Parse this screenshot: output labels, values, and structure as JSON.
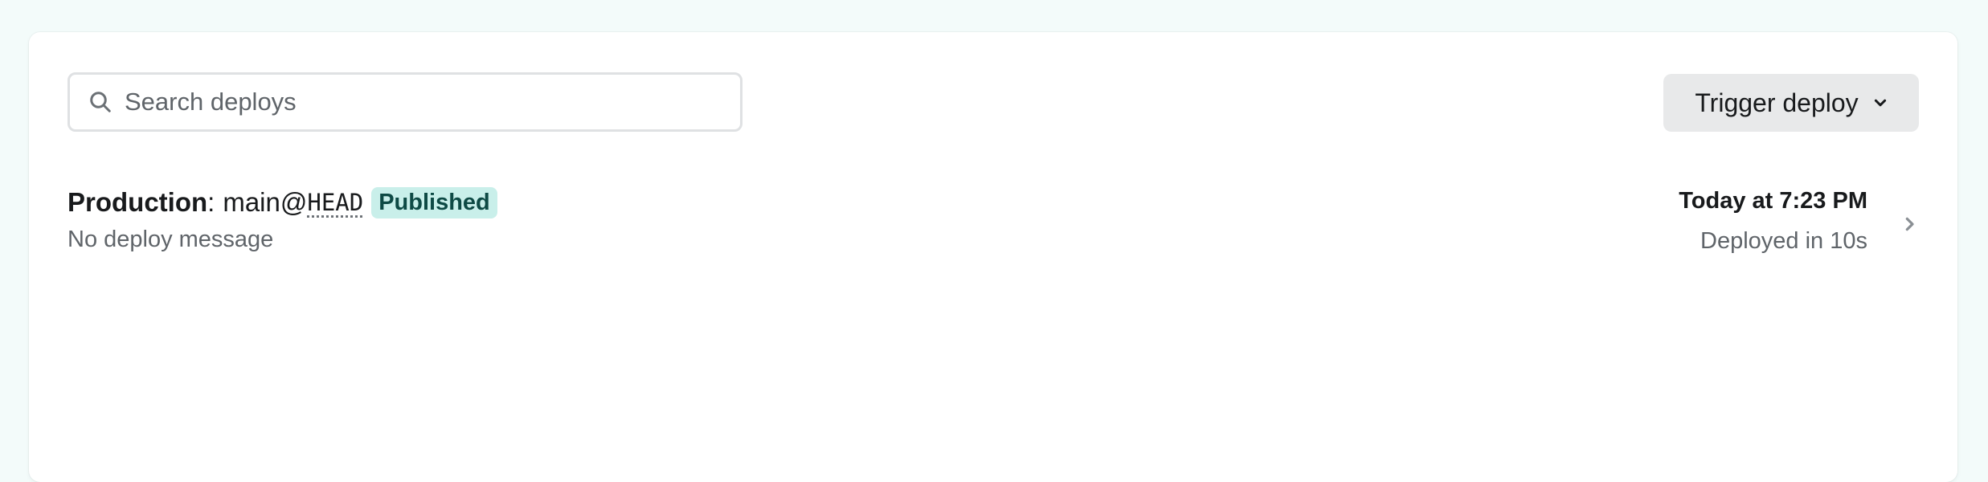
{
  "search": {
    "placeholder": "Search deploys",
    "value": ""
  },
  "toolbar": {
    "trigger_label": "Trigger deploy"
  },
  "deploys": [
    {
      "context": "Production",
      "separator": ":",
      "branch": "main@",
      "ref": "HEAD",
      "status": "Published",
      "message": "No deploy message",
      "time": "Today at 7:23 PM",
      "duration": "Deployed in 10s"
    }
  ],
  "icons": {
    "search": "search-icon",
    "trigger_chevron": "chevron-down-icon",
    "row_chevron": "chevron-right-icon"
  },
  "colors": {
    "page_background": "#f3fbfa",
    "badge_background": "#c9efea",
    "badge_text": "#0e4a45",
    "button_background": "#e8e9ea"
  }
}
